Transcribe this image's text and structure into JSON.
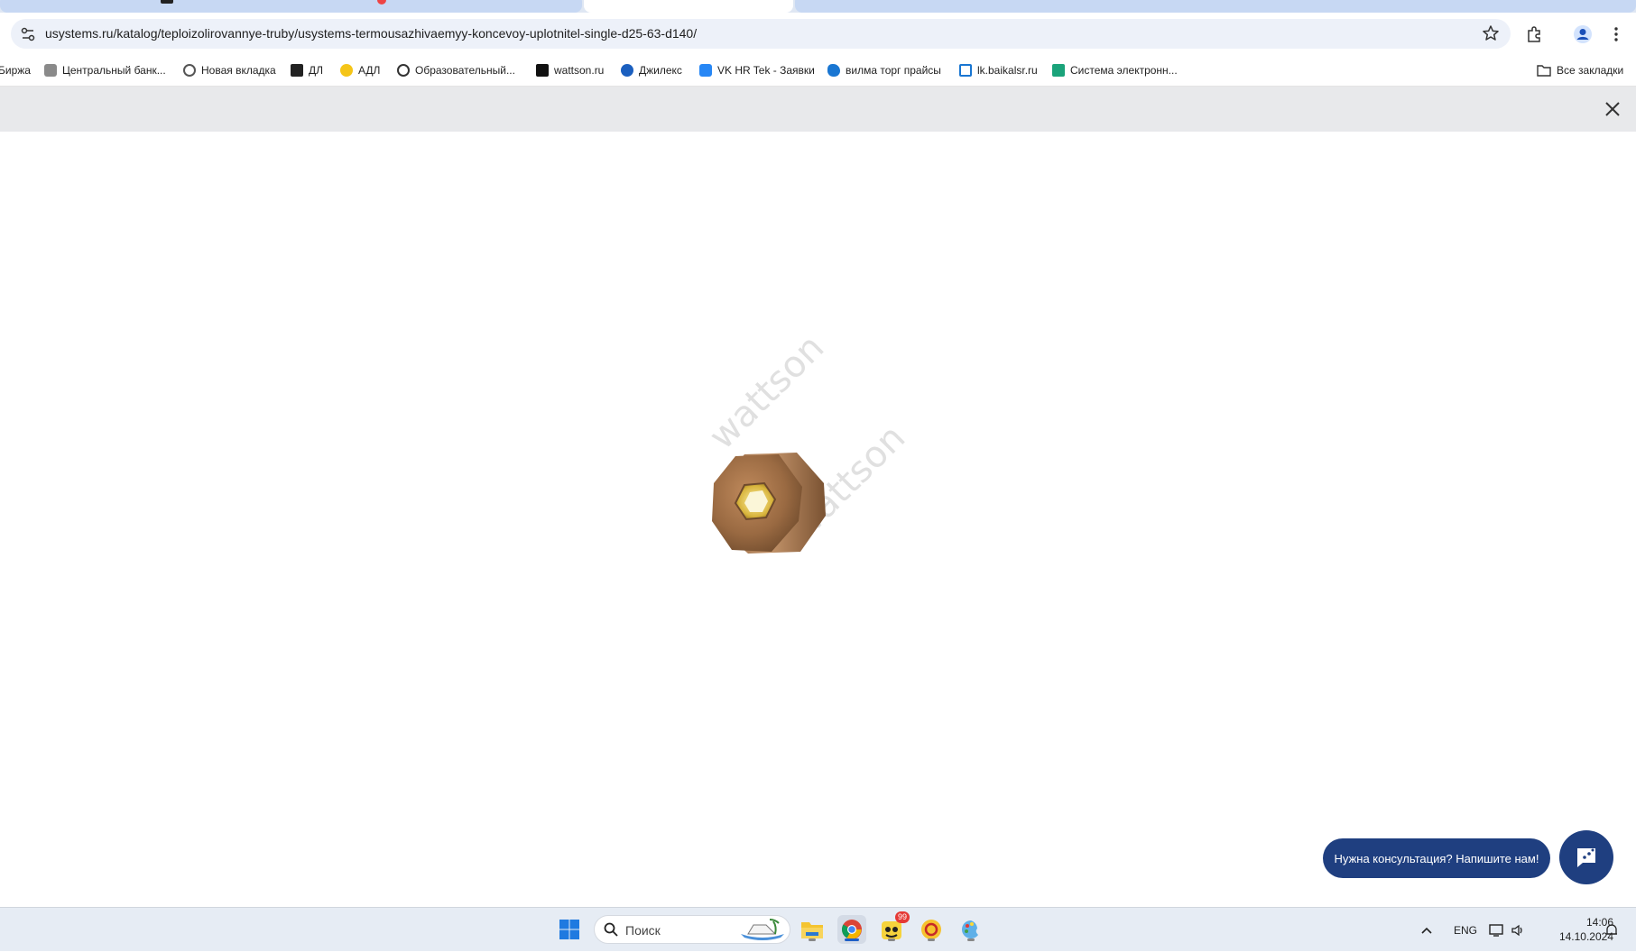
{
  "browser": {
    "url": "usystems.ru/katalog/teploizolirovannye-truby/usystems-termousazhivaemyy-koncevoy-uplotnitel-single-d25-63-d140/"
  },
  "bookmarks": [
    {
      "label": "Биржа",
      "icon": "bank-icon"
    },
    {
      "label": "Центральный банк...",
      "icon": "eagle-icon"
    },
    {
      "label": "Новая вкладка",
      "icon": "globe-icon"
    },
    {
      "label": "ДЛ",
      "icon": "dl-logo-icon"
    },
    {
      "label": "АДЛ",
      "icon": "1c-logo-icon"
    },
    {
      "label": "Образовательный...",
      "icon": "edu-icon"
    },
    {
      "label": "wattson.ru",
      "icon": "w-logo-icon"
    },
    {
      "label": "Джилекс",
      "icon": "jileks-icon"
    },
    {
      "label": "VK HR Tek - Заявки",
      "icon": "vk-icon"
    },
    {
      "label": "вилма торг прайсы",
      "icon": "cloud-icon"
    },
    {
      "label": "lk.baikalsr.ru",
      "icon": "x-logo-icon"
    },
    {
      "label": "Система электронн...",
      "icon": "doc-icon"
    }
  ],
  "all_bookmarks": "Все закладки",
  "viewer": {
    "watermark": "wattson"
  },
  "chat": {
    "label": "Нужна консультация? Напишите нам!"
  },
  "taskbar": {
    "search_placeholder": "Поиск",
    "lang": "ENG",
    "time": "14:06",
    "date": "14.10.2024",
    "badge": "99"
  },
  "colors": {
    "chat_bg": "#1f3f80",
    "taskbar_bg": "#e6ecf4",
    "grey_bar": "#e8e9eb"
  }
}
